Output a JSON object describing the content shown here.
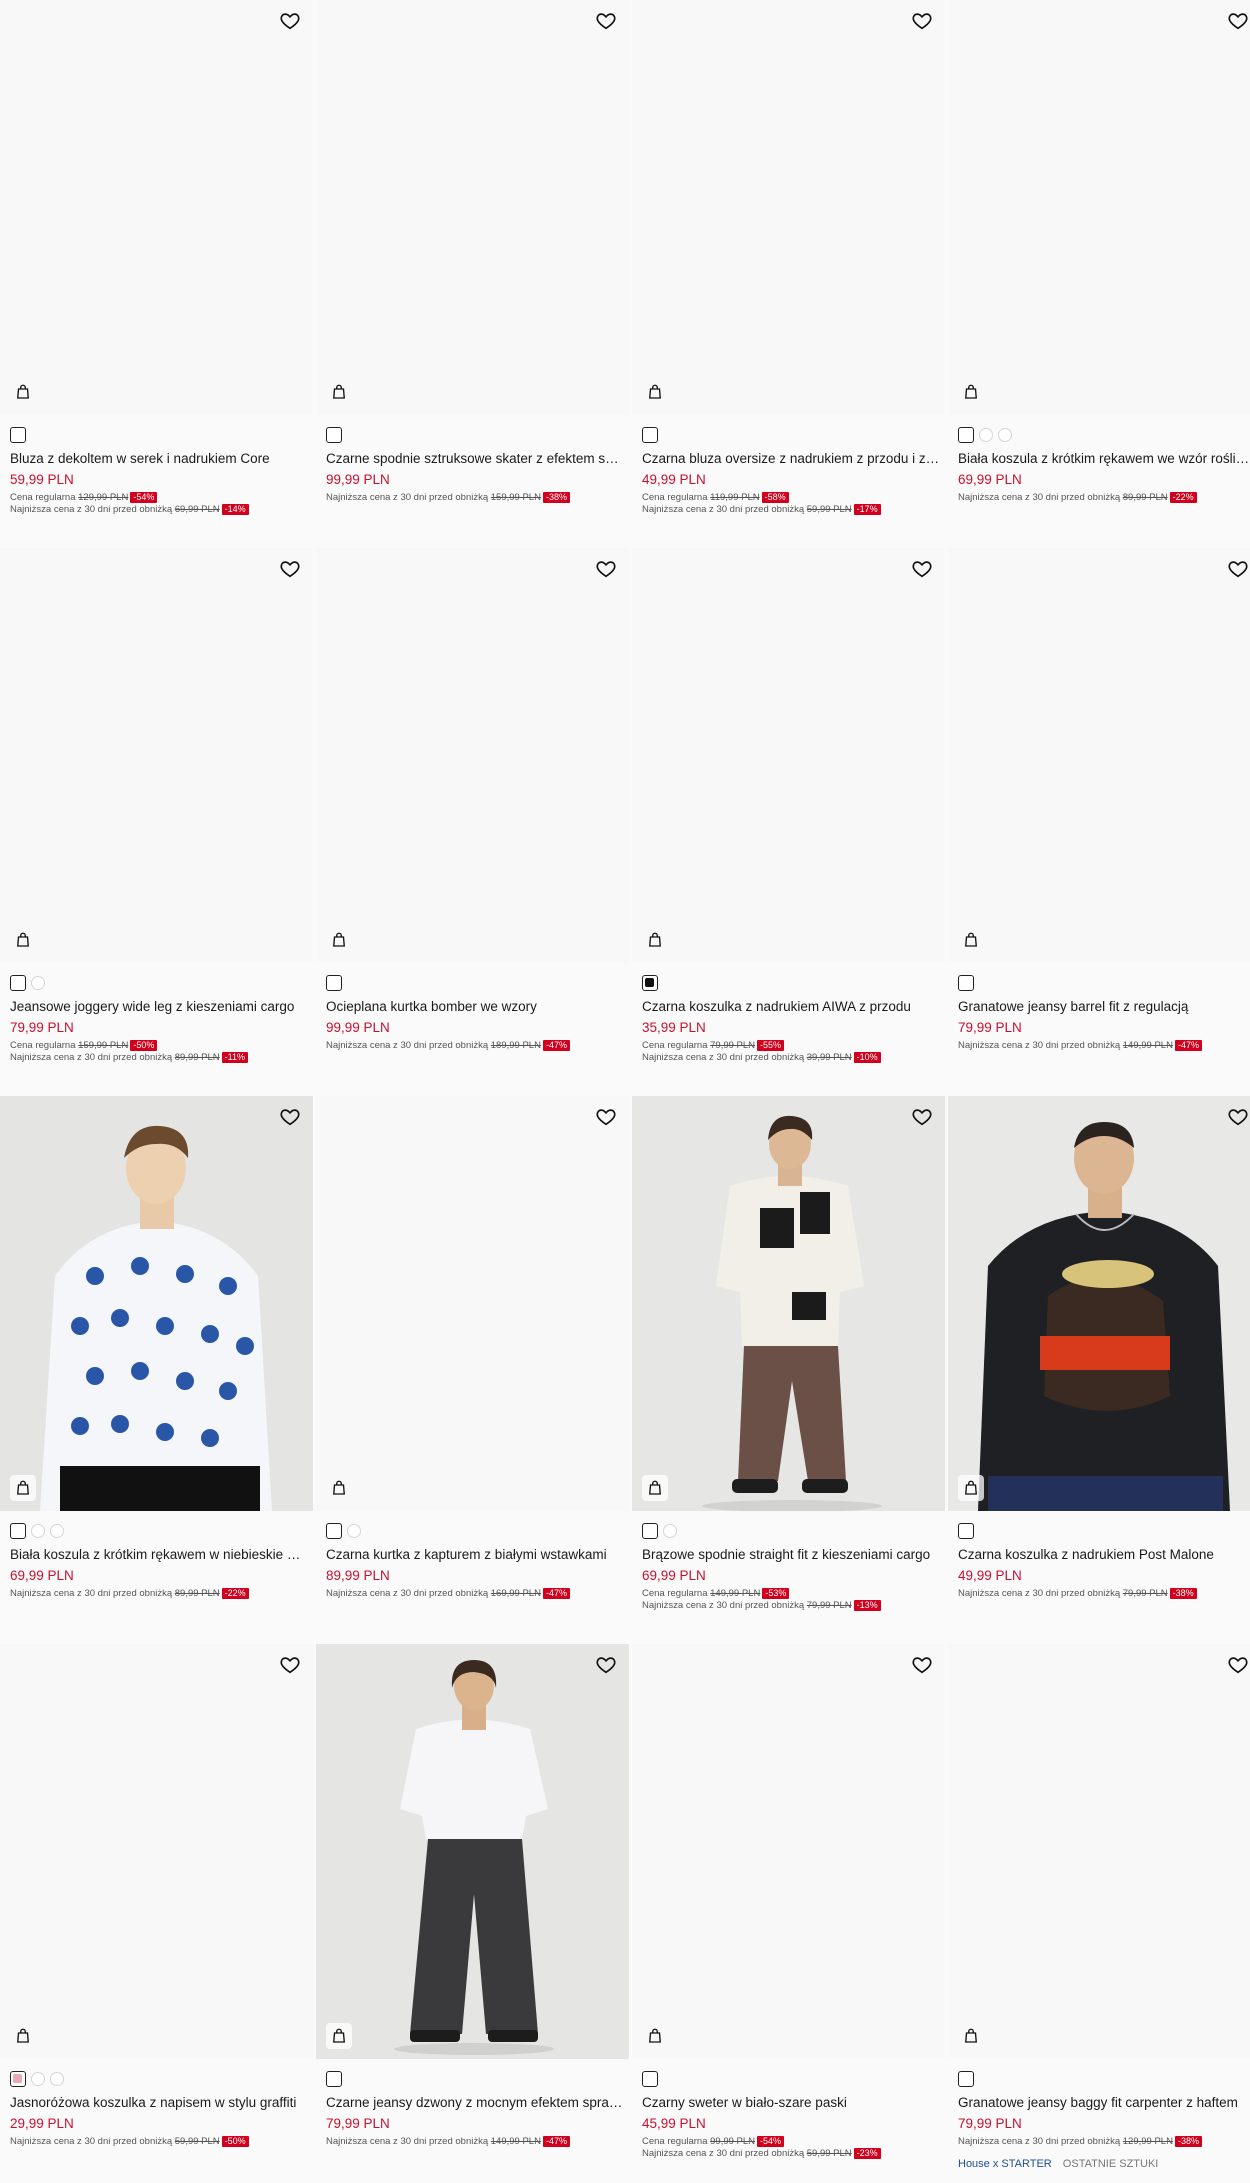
{
  "icons": {
    "wishlist": "heart-outline-icon",
    "cart": "shopping-bag-icon"
  },
  "colors": {
    "sale_price": "#c8102e",
    "discount_badge": "#d2001c",
    "collab_tag": "#1f4f96"
  },
  "products": [
    {
      "name": "Bluza z dekoltem w serek i nadrukiem Core",
      "price": "59,99 PLN",
      "info": [
        {
          "label": "Cena regularna",
          "old": "129,99 PLN",
          "discount": "-54%"
        },
        {
          "label": "Najniższa cena z 30 dni przed obniżką",
          "old": "69,99 PLN",
          "discount": "-14%"
        }
      ]
    },
    {
      "name": "Czarne spodnie sztruksowe skater z efektem sprania",
      "price": "99,99 PLN",
      "info": [
        {
          "label": "Najniższa cena z 30 dni przed obniżką",
          "old": "159,99 PLN",
          "discount": "-38%"
        }
      ]
    },
    {
      "name": "Czarna bluza oversize z nadrukiem z przodu i z tyłu",
      "price": "49,99 PLN",
      "info": [
        {
          "label": "Cena regularna",
          "old": "119,99 PLN",
          "discount": "-58%"
        },
        {
          "label": "Najniższa cena z 30 dni przed obniżką",
          "old": "59,99 PLN",
          "discount": "-17%"
        }
      ]
    },
    {
      "name": "Biała koszula z krótkim rękawem we wzór roślinny",
      "price": "69,99 PLN",
      "info": [
        {
          "label": "Najniższa cena z 30 dni przed obniżką",
          "old": "89,99 PLN",
          "discount": "-22%"
        }
      ]
    },
    {
      "name": "Jeansowe joggery wide leg z kieszeniami cargo",
      "price": "79,99 PLN",
      "info": [
        {
          "label": "Cena regularna",
          "old": "159,99 PLN",
          "discount": "-50%"
        },
        {
          "label": "Najniższa cena z 30 dni przed obniżką",
          "old": "89,99 PLN",
          "discount": "-11%"
        }
      ]
    },
    {
      "name": "Ocieplana kurtka bomber we wzory",
      "price": "99,99 PLN",
      "info": [
        {
          "label": "Najniższa cena z 30 dni przed obniżką",
          "old": "189,99 PLN",
          "discount": "-47%"
        }
      ]
    },
    {
      "name": "Czarna koszulka z nadrukiem AIWA z przodu",
      "price": "35,99 PLN",
      "info": [
        {
          "label": "Cena regularna",
          "old": "79,99 PLN",
          "discount": "-55%"
        },
        {
          "label": "Najniższa cena z 30 dni przed obniżką",
          "old": "39,99 PLN",
          "discount": "-10%"
        }
      ]
    },
    {
      "name": "Granatowe jeansy barrel fit z regulacją",
      "price": "79,99 PLN",
      "info": [
        {
          "label": "Najniższa cena z 30 dni przed obniżką",
          "old": "149,99 PLN",
          "discount": "-47%"
        }
      ]
    },
    {
      "name": "Biała koszula z krótkim rękawem w niebieskie wzory",
      "price": "69,99 PLN",
      "info": [
        {
          "label": "Najniższa cena z 30 dni przed obniżką",
          "old": "89,99 PLN",
          "discount": "-22%"
        }
      ]
    },
    {
      "name": "Czarna kurtka z kapturem z białymi wstawkami",
      "price": "89,99 PLN",
      "info": [
        {
          "label": "Najniższa cena z 30 dni przed obniżką",
          "old": "169,99 PLN",
          "discount": "-47%"
        }
      ]
    },
    {
      "name": "Brązowe spodnie straight fit z kieszeniami cargo",
      "price": "69,99 PLN",
      "info": [
        {
          "label": "Cena regularna",
          "old": "149,99 PLN",
          "discount": "-53%"
        },
        {
          "label": "Najniższa cena z 30 dni przed obniżką",
          "old": "79,99 PLN",
          "discount": "-13%"
        }
      ]
    },
    {
      "name": "Czarna koszulka z nadrukiem Post Malone",
      "price": "49,99 PLN",
      "info": [
        {
          "label": "Najniższa cena z 30 dni przed obniżką",
          "old": "79,99 PLN",
          "discount": "-38%"
        }
      ]
    },
    {
      "name": "Jasnoróżowa koszulka z napisem w stylu graffiti",
      "price": "29,99 PLN",
      "info": [
        {
          "label": "Najniższa cena z 30 dni przed obniżką",
          "old": "59,99 PLN",
          "discount": "-50%"
        }
      ]
    },
    {
      "name": "Czarne jeansy dzwony z mocnym efektem sprania",
      "price": "79,99 PLN",
      "info": [
        {
          "label": "Najniższa cena z 30 dni przed obniżką",
          "old": "149,99 PLN",
          "discount": "-47%"
        }
      ]
    },
    {
      "name": "Czarny sweter w biało-szare paski",
      "price": "45,99 PLN",
      "info": [
        {
          "label": "Cena regularna",
          "old": "99,99 PLN",
          "discount": "-54%"
        },
        {
          "label": "Najniższa cena z 30 dni przed obniżką",
          "old": "59,99 PLN",
          "discount": "-23%"
        }
      ]
    },
    {
      "name": "Granatowe jeansy baggy fit carpenter z haftem",
      "price": "79,99 PLN",
      "info": [
        {
          "label": "Najniższa cena z 30 dni przed obniżką",
          "old": "129,99 PLN",
          "discount": "-38%"
        }
      ],
      "tags": {
        "collab": "House x STARTER",
        "stock": "OSTATNIE SZTUKI"
      }
    }
  ]
}
